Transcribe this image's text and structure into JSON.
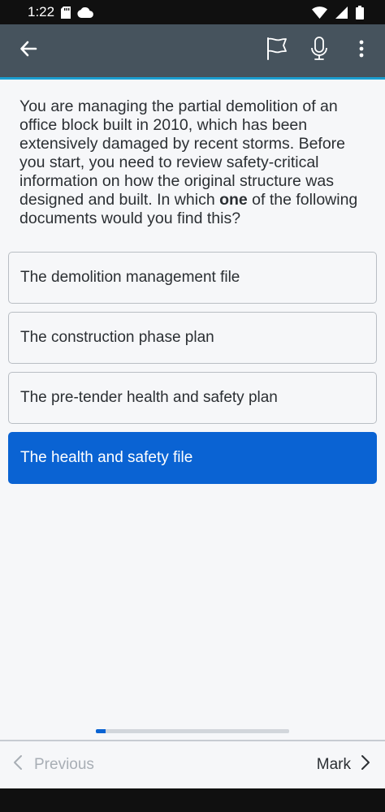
{
  "status_bar": {
    "time": "1:22",
    "icons": [
      "sd-card-icon",
      "cloud-icon",
      "wifi-icon",
      "signal-icon",
      "battery-icon"
    ]
  },
  "app_bar": {
    "back_icon": "arrow-left-icon",
    "actions": [
      "flag-icon",
      "microphone-icon",
      "more-vertical-icon"
    ],
    "background": "#46535d",
    "accent": "#1a9ed0"
  },
  "question": {
    "text_before": "You are managing the partial demolition of an office block built in 2010, which has been extensively damaged by recent storms. Before you start, you need to review safety-critical information on how the original structure was designed and built. In which ",
    "emphasis": "one",
    "text_after": " of the following documents would you find this?"
  },
  "answers": [
    {
      "label": "The demolition management file",
      "selected": false
    },
    {
      "label": "The construction phase plan",
      "selected": false
    },
    {
      "label": "The pre-tender health and safety plan",
      "selected": false
    },
    {
      "label": "The health and safety file",
      "selected": true
    }
  ],
  "progress": {
    "fraction": 0.05,
    "fill_color": "#0a63d3"
  },
  "bottom_nav": {
    "previous_label": "Previous",
    "mark_label": "Mark"
  },
  "colors": {
    "selected": "#0a63d3",
    "background": "#f6f7f9",
    "text": "#2b2f33"
  }
}
